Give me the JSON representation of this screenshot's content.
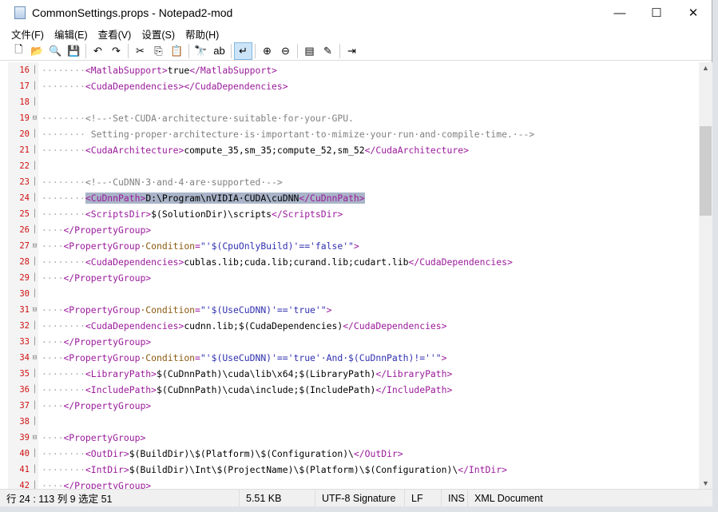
{
  "window": {
    "title": "CommonSettings.props - Notepad2-mod",
    "minimize": "—",
    "maximize": "☐",
    "close": "✕"
  },
  "menu": [
    "文件(F)",
    "编辑(E)",
    "查看(V)",
    "设置(S)",
    "帮助(H)"
  ],
  "toolbar": [
    {
      "name": "new-file-icon",
      "glyph": "🗋"
    },
    {
      "name": "open-folder-icon",
      "glyph": "📂"
    },
    {
      "name": "browse-icon",
      "glyph": "🔍"
    },
    {
      "name": "save-icon",
      "glyph": "💾"
    },
    {
      "sep": true
    },
    {
      "name": "undo-icon",
      "glyph": "↶"
    },
    {
      "name": "redo-icon",
      "glyph": "↷"
    },
    {
      "sep": true
    },
    {
      "name": "cut-icon",
      "glyph": "✂"
    },
    {
      "name": "copy-icon",
      "glyph": "⎘"
    },
    {
      "name": "paste-icon",
      "glyph": "📋"
    },
    {
      "sep": true
    },
    {
      "name": "find-icon",
      "glyph": "🔭"
    },
    {
      "name": "replace-icon",
      "glyph": "ab"
    },
    {
      "sep": true
    },
    {
      "name": "word-wrap-icon",
      "glyph": "↵",
      "active": true
    },
    {
      "sep": true
    },
    {
      "name": "zoom-in-icon",
      "glyph": "⊕"
    },
    {
      "name": "zoom-out-icon",
      "glyph": "⊖"
    },
    {
      "sep": true
    },
    {
      "name": "scheme-icon",
      "glyph": "▤"
    },
    {
      "name": "customize-scheme-icon",
      "glyph": "✎"
    },
    {
      "sep": true
    },
    {
      "name": "exit-icon",
      "glyph": "⇥"
    }
  ],
  "editor": {
    "lines": [
      {
        "n": "16",
        "segs": [
          [
            "d",
            "········"
          ],
          [
            "t",
            "<MatlabSupport>"
          ],
          [
            "x",
            "true"
          ],
          [
            "t",
            "</MatlabSupport>"
          ]
        ]
      },
      {
        "n": "17",
        "segs": [
          [
            "d",
            "········"
          ],
          [
            "t",
            "<CudaDependencies></CudaDependencies>"
          ]
        ]
      },
      {
        "n": "18",
        "segs": []
      },
      {
        "n": "19",
        "fold": true,
        "segs": [
          [
            "d",
            "········"
          ],
          [
            "c",
            "<!--·Set·CUDA·architecture·suitable·for·your·GPU."
          ]
        ]
      },
      {
        "n": "20",
        "segs": [
          [
            "d",
            "········"
          ],
          [
            "c",
            " Setting·proper·architecture·is·important·to·mimize·your·run·and·compile·time.·-->"
          ]
        ]
      },
      {
        "n": "21",
        "segs": [
          [
            "d",
            "········"
          ],
          [
            "t",
            "<CudaArchitecture>"
          ],
          [
            "x",
            "compute_35,sm_35;compute_52,sm_52"
          ],
          [
            "t",
            "</CudaArchitecture>"
          ]
        ]
      },
      {
        "n": "22",
        "segs": []
      },
      {
        "n": "23",
        "segs": [
          [
            "d",
            "········"
          ],
          [
            "c",
            "<!--·CuDNN·3·and·4·are·supported·-->"
          ]
        ]
      },
      {
        "n": "24",
        "selected": true,
        "segs": [
          [
            "d",
            "········"
          ],
          [
            "t",
            "<CuDnnPath>"
          ],
          [
            "x",
            "D:\\Program\\nVIDIA·CUDA\\cuDNN"
          ],
          [
            "t",
            "</CuDnnPath>"
          ]
        ]
      },
      {
        "n": "25",
        "segs": [
          [
            "d",
            "········"
          ],
          [
            "t",
            "<ScriptsDir>"
          ],
          [
            "x",
            "$(SolutionDir)\\scripts"
          ],
          [
            "t",
            "</ScriptsDir>"
          ]
        ]
      },
      {
        "n": "26",
        "segs": [
          [
            "d",
            "····"
          ],
          [
            "t",
            "</PropertyGroup>"
          ]
        ]
      },
      {
        "n": "27",
        "fold": true,
        "segs": [
          [
            "d",
            "····"
          ],
          [
            "t",
            "<PropertyGroup"
          ],
          [
            "a",
            "·Condition"
          ],
          [
            "t",
            "="
          ],
          [
            "v",
            "\"'$(CpuOnlyBuild)'=='false'\""
          ],
          [
            "t",
            ">"
          ]
        ]
      },
      {
        "n": "28",
        "segs": [
          [
            "d",
            "········"
          ],
          [
            "t",
            "<CudaDependencies>"
          ],
          [
            "x",
            "cublas.lib;cuda.lib;curand.lib;cudart.lib"
          ],
          [
            "t",
            "</CudaDependencies>"
          ]
        ]
      },
      {
        "n": "29",
        "segs": [
          [
            "d",
            "····"
          ],
          [
            "t",
            "</PropertyGroup>"
          ]
        ]
      },
      {
        "n": "30",
        "segs": []
      },
      {
        "n": "31",
        "fold": true,
        "segs": [
          [
            "d",
            "····"
          ],
          [
            "t",
            "<PropertyGroup"
          ],
          [
            "a",
            "·Condition"
          ],
          [
            "t",
            "="
          ],
          [
            "v",
            "\"'$(UseCuDNN)'=='true'\""
          ],
          [
            "t",
            ">"
          ]
        ]
      },
      {
        "n": "32",
        "segs": [
          [
            "d",
            "········"
          ],
          [
            "t",
            "<CudaDependencies>"
          ],
          [
            "x",
            "cudnn.lib;$(CudaDependencies)"
          ],
          [
            "t",
            "</CudaDependencies>"
          ]
        ]
      },
      {
        "n": "33",
        "segs": [
          [
            "d",
            "····"
          ],
          [
            "t",
            "</PropertyGroup>"
          ]
        ]
      },
      {
        "n": "34",
        "fold": true,
        "segs": [
          [
            "d",
            "····"
          ],
          [
            "t",
            "<PropertyGroup"
          ],
          [
            "a",
            "·Condition"
          ],
          [
            "t",
            "="
          ],
          [
            "v",
            "\"'$(UseCuDNN)'=='true'·And·$(CuDnnPath)!=''\""
          ],
          [
            "t",
            ">"
          ]
        ]
      },
      {
        "n": "35",
        "segs": [
          [
            "d",
            "········"
          ],
          [
            "t",
            "<LibraryPath>"
          ],
          [
            "x",
            "$(CuDnnPath)\\cuda\\lib\\x64;$(LibraryPath)"
          ],
          [
            "t",
            "</LibraryPath>"
          ]
        ]
      },
      {
        "n": "36",
        "segs": [
          [
            "d",
            "········"
          ],
          [
            "t",
            "<IncludePath>"
          ],
          [
            "x",
            "$(CuDnnPath)\\cuda\\include;$(IncludePath)"
          ],
          [
            "t",
            "</IncludePath>"
          ]
        ]
      },
      {
        "n": "37",
        "segs": [
          [
            "d",
            "····"
          ],
          [
            "t",
            "</PropertyGroup>"
          ]
        ]
      },
      {
        "n": "38",
        "segs": []
      },
      {
        "n": "39",
        "fold": true,
        "segs": [
          [
            "d",
            "····"
          ],
          [
            "t",
            "<PropertyGroup>"
          ]
        ]
      },
      {
        "n": "40",
        "segs": [
          [
            "d",
            "········"
          ],
          [
            "t",
            "<OutDir>"
          ],
          [
            "x",
            "$(BuildDir)\\$(Platform)\\$(Configuration)\\"
          ],
          [
            "t",
            "</OutDir>"
          ]
        ]
      },
      {
        "n": "41",
        "segs": [
          [
            "d",
            "········"
          ],
          [
            "t",
            "<IntDir>"
          ],
          [
            "x",
            "$(BuildDir)\\Int\\$(ProjectName)\\$(Platform)\\$(Configuration)\\"
          ],
          [
            "t",
            "</IntDir>"
          ]
        ]
      },
      {
        "n": "42",
        "segs": [
          [
            "d",
            "····"
          ],
          [
            "t",
            "</PropertyGroup>"
          ]
        ]
      }
    ]
  },
  "status": {
    "position": "行 24 : 113   列 9   选定 51",
    "size": "5.51 KB",
    "encoding": "UTF-8 Signature",
    "eol": "LF",
    "mode": "INS",
    "lexer": "XML Document"
  }
}
